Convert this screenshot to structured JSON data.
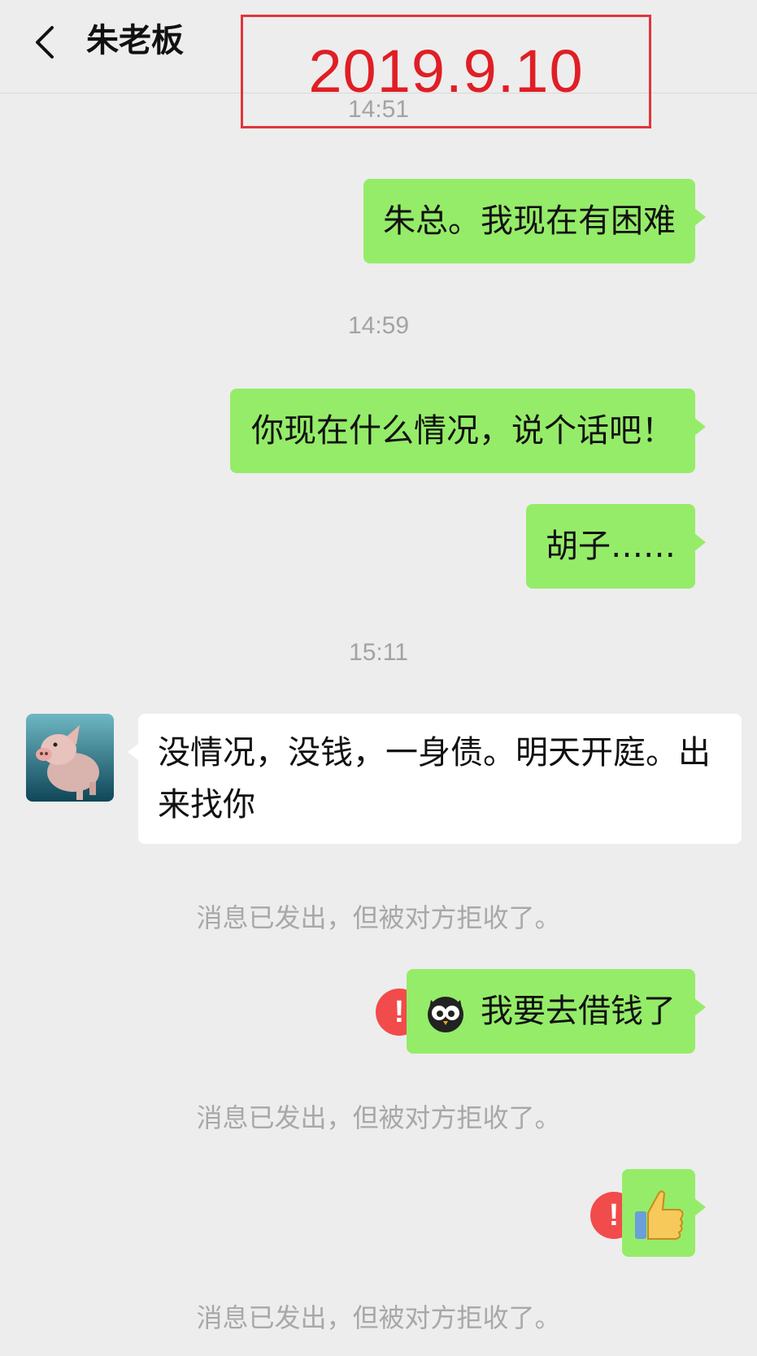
{
  "header": {
    "back_icon": "chevron-left-icon",
    "title": "朱老板"
  },
  "date_annotation": "2019.9.10",
  "messages": [
    {
      "type": "timestamp",
      "text": "14:51"
    },
    {
      "type": "sent",
      "text": "朱总。我现在有困难"
    },
    {
      "type": "timestamp",
      "text": "14:59"
    },
    {
      "type": "sent",
      "text": "你现在什么情况，说个话吧！"
    },
    {
      "type": "sent",
      "text": "胡子……"
    },
    {
      "type": "timestamp",
      "text": "15:11"
    },
    {
      "type": "received",
      "text": "没情况，没钱，一身债。明天开庭。出来找你",
      "avatar": "pig-avatar"
    },
    {
      "type": "system",
      "text": "消息已发出，但被对方拒收了。"
    },
    {
      "type": "sent",
      "text": "我要去借钱了",
      "emoji": "owl-emoji-icon",
      "status": "failed"
    },
    {
      "type": "system",
      "text": "消息已发出，但被对方拒收了。"
    },
    {
      "type": "sent",
      "emoji": "thumbs-up-icon",
      "status": "failed"
    },
    {
      "type": "system",
      "text": "消息已发出，但被对方拒收了。"
    }
  ],
  "colors": {
    "background": "#ededed",
    "sent_bubble": "#95ec69",
    "received_bubble": "#ffffff",
    "error": "#f24b4b",
    "annotation_red": "#e01e25",
    "muted_text": "#a8a8a8"
  }
}
